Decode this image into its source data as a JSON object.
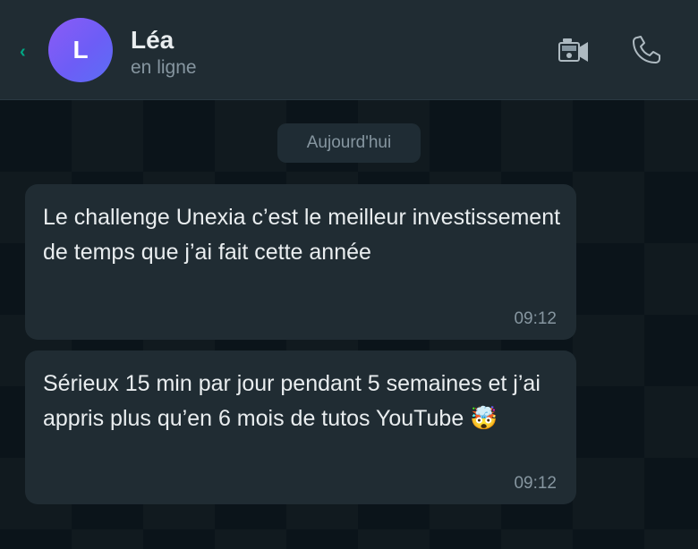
{
  "header": {
    "back_icon": "chevron-left-icon",
    "avatar_initial": "L",
    "contact_name": "Léa",
    "contact_status": "en ligne",
    "video_icon": "video-camera-icon",
    "phone_icon": "phone-icon"
  },
  "chat": {
    "date_separator": "Aujourd'hui",
    "messages": [
      {
        "text": "Le challenge Unexia c’est le meilleur investissement de temps que j’ai fait cette année",
        "time": "09:12"
      },
      {
        "text": "Sérieux 15 min par jour pendant 5 semaines et j’ai appris plus qu’en 6 mois de tutos YouTube 🤯",
        "time": "09:12"
      }
    ]
  },
  "colors": {
    "accent": "#00a884",
    "header_bg": "#202c33",
    "chat_bg": "#0b141a",
    "bubble_bg": "#202c33",
    "avatar_gradient_start": "#8b5cf6",
    "avatar_gradient_end": "#5b6ef5"
  }
}
